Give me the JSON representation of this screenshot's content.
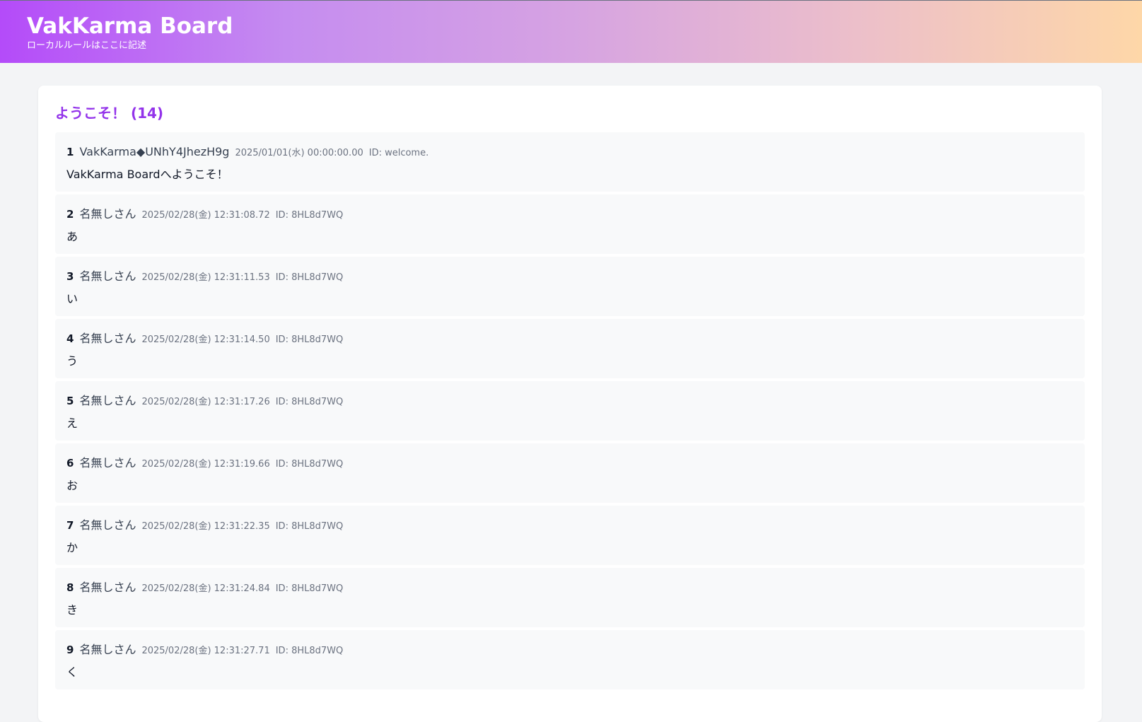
{
  "header": {
    "title": "VakKarma Board",
    "local_rule": "ローカルルールはここに記述"
  },
  "thread": {
    "title": "ようこそ！ (14)",
    "posts": [
      {
        "num": "1",
        "name": "VakKarma◆UNhY4JhezH9g",
        "date": "2025/01/01(水) 00:00:00.00",
        "id": "ID: welcome.",
        "body": "VakKarma Boardへようこそ！"
      },
      {
        "num": "2",
        "name": "名無しさん",
        "date": "2025/02/28(金) 12:31:08.72",
        "id": "ID: 8HL8d7WQ",
        "body": "あ"
      },
      {
        "num": "3",
        "name": "名無しさん",
        "date": "2025/02/28(金) 12:31:11.53",
        "id": "ID: 8HL8d7WQ",
        "body": "い"
      },
      {
        "num": "4",
        "name": "名無しさん",
        "date": "2025/02/28(金) 12:31:14.50",
        "id": "ID: 8HL8d7WQ",
        "body": "う"
      },
      {
        "num": "5",
        "name": "名無しさん",
        "date": "2025/02/28(金) 12:31:17.26",
        "id": "ID: 8HL8d7WQ",
        "body": "え"
      },
      {
        "num": "6",
        "name": "名無しさん",
        "date": "2025/02/28(金) 12:31:19.66",
        "id": "ID: 8HL8d7WQ",
        "body": "お"
      },
      {
        "num": "7",
        "name": "名無しさん",
        "date": "2025/02/28(金) 12:31:22.35",
        "id": "ID: 8HL8d7WQ",
        "body": "か"
      },
      {
        "num": "8",
        "name": "名無しさん",
        "date": "2025/02/28(金) 12:31:24.84",
        "id": "ID: 8HL8d7WQ",
        "body": "き"
      },
      {
        "num": "9",
        "name": "名無しさん",
        "date": "2025/02/28(金) 12:31:27.71",
        "id": "ID: 8HL8d7WQ",
        "body": "く"
      }
    ]
  },
  "colors": {
    "title_accent": "#9333ea",
    "header_gradient_start": "#b44bf9",
    "header_gradient_end": "#fed7a8"
  }
}
